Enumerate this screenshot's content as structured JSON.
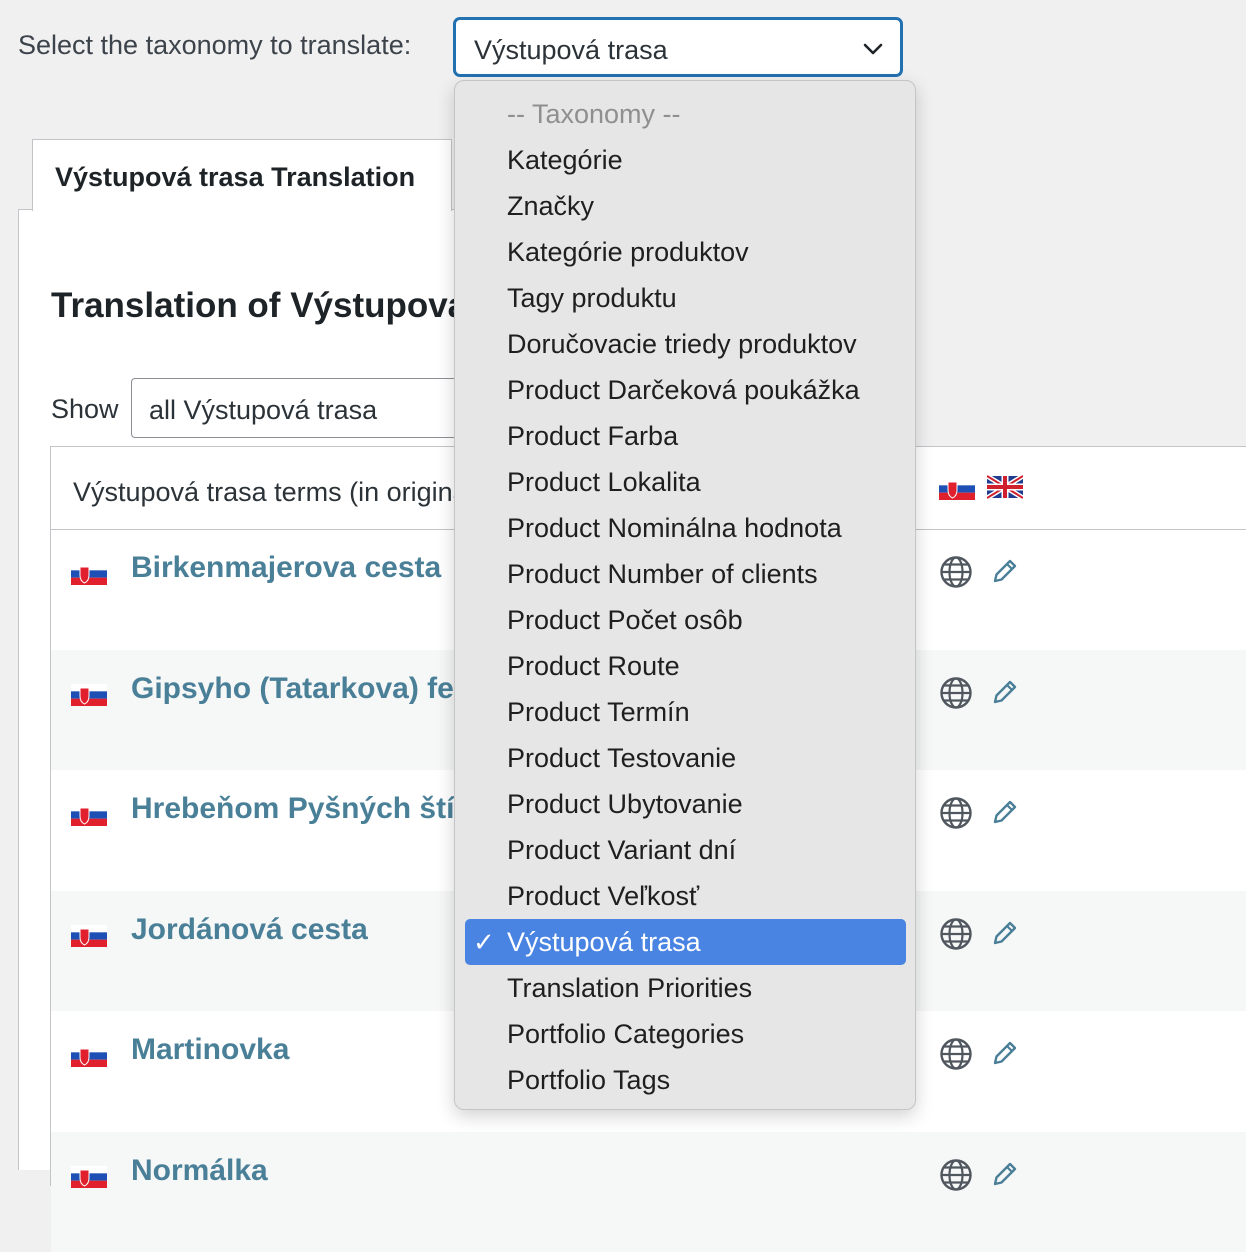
{
  "taxonomy_select": {
    "label": "Select the taxonomy to translate:",
    "value": "Výstupová trasa",
    "icon": "chevron-down-icon"
  },
  "tab": {
    "label": "Výstupová trasa Translation"
  },
  "heading": "Translation of Výstupová trasa",
  "show": {
    "label": "Show",
    "value": "all Výstupová trasa"
  },
  "table": {
    "column_header": "Výstupová trasa terms (in original language)",
    "header_flags": [
      "slovak-flag-icon",
      "uk-flag-icon"
    ],
    "rows": [
      {
        "term": "Birkenmajerova cesta"
      },
      {
        "term": "Gipsyho (Tatarkova) ferrata"
      },
      {
        "term": "Hrebeňom Pyšných štítov"
      },
      {
        "term": "Jordánová cesta"
      },
      {
        "term": "Martinovka"
      },
      {
        "term": "Normálka"
      }
    ]
  },
  "dropdown": {
    "options": [
      "-- Taxonomy --",
      "Kategórie",
      "Značky",
      "Kategórie produktov",
      "Tagy produktu",
      "Doručovacie triedy produktov",
      "Product Darčeková poukážka",
      "Product Farba",
      "Product Lokalita",
      "Product Nominálna hodnota",
      "Product Number of clients",
      "Product Počet osôb",
      "Product Route",
      "Product Termín",
      "Product Testovanie",
      "Product Ubytovanie",
      "Product Variant dní",
      "Product Veľkosť",
      "Výstupová trasa",
      "Translation Priorities",
      "Portfolio Categories",
      "Portfolio Tags"
    ],
    "selected": "Výstupová trasa",
    "placeholder": "-- Taxonomy --",
    "check_glyph": "✓"
  },
  "colors": {
    "accent": "#2271b1",
    "selected_highlight": "#4a84e2",
    "term_link": "#4a7f98"
  }
}
